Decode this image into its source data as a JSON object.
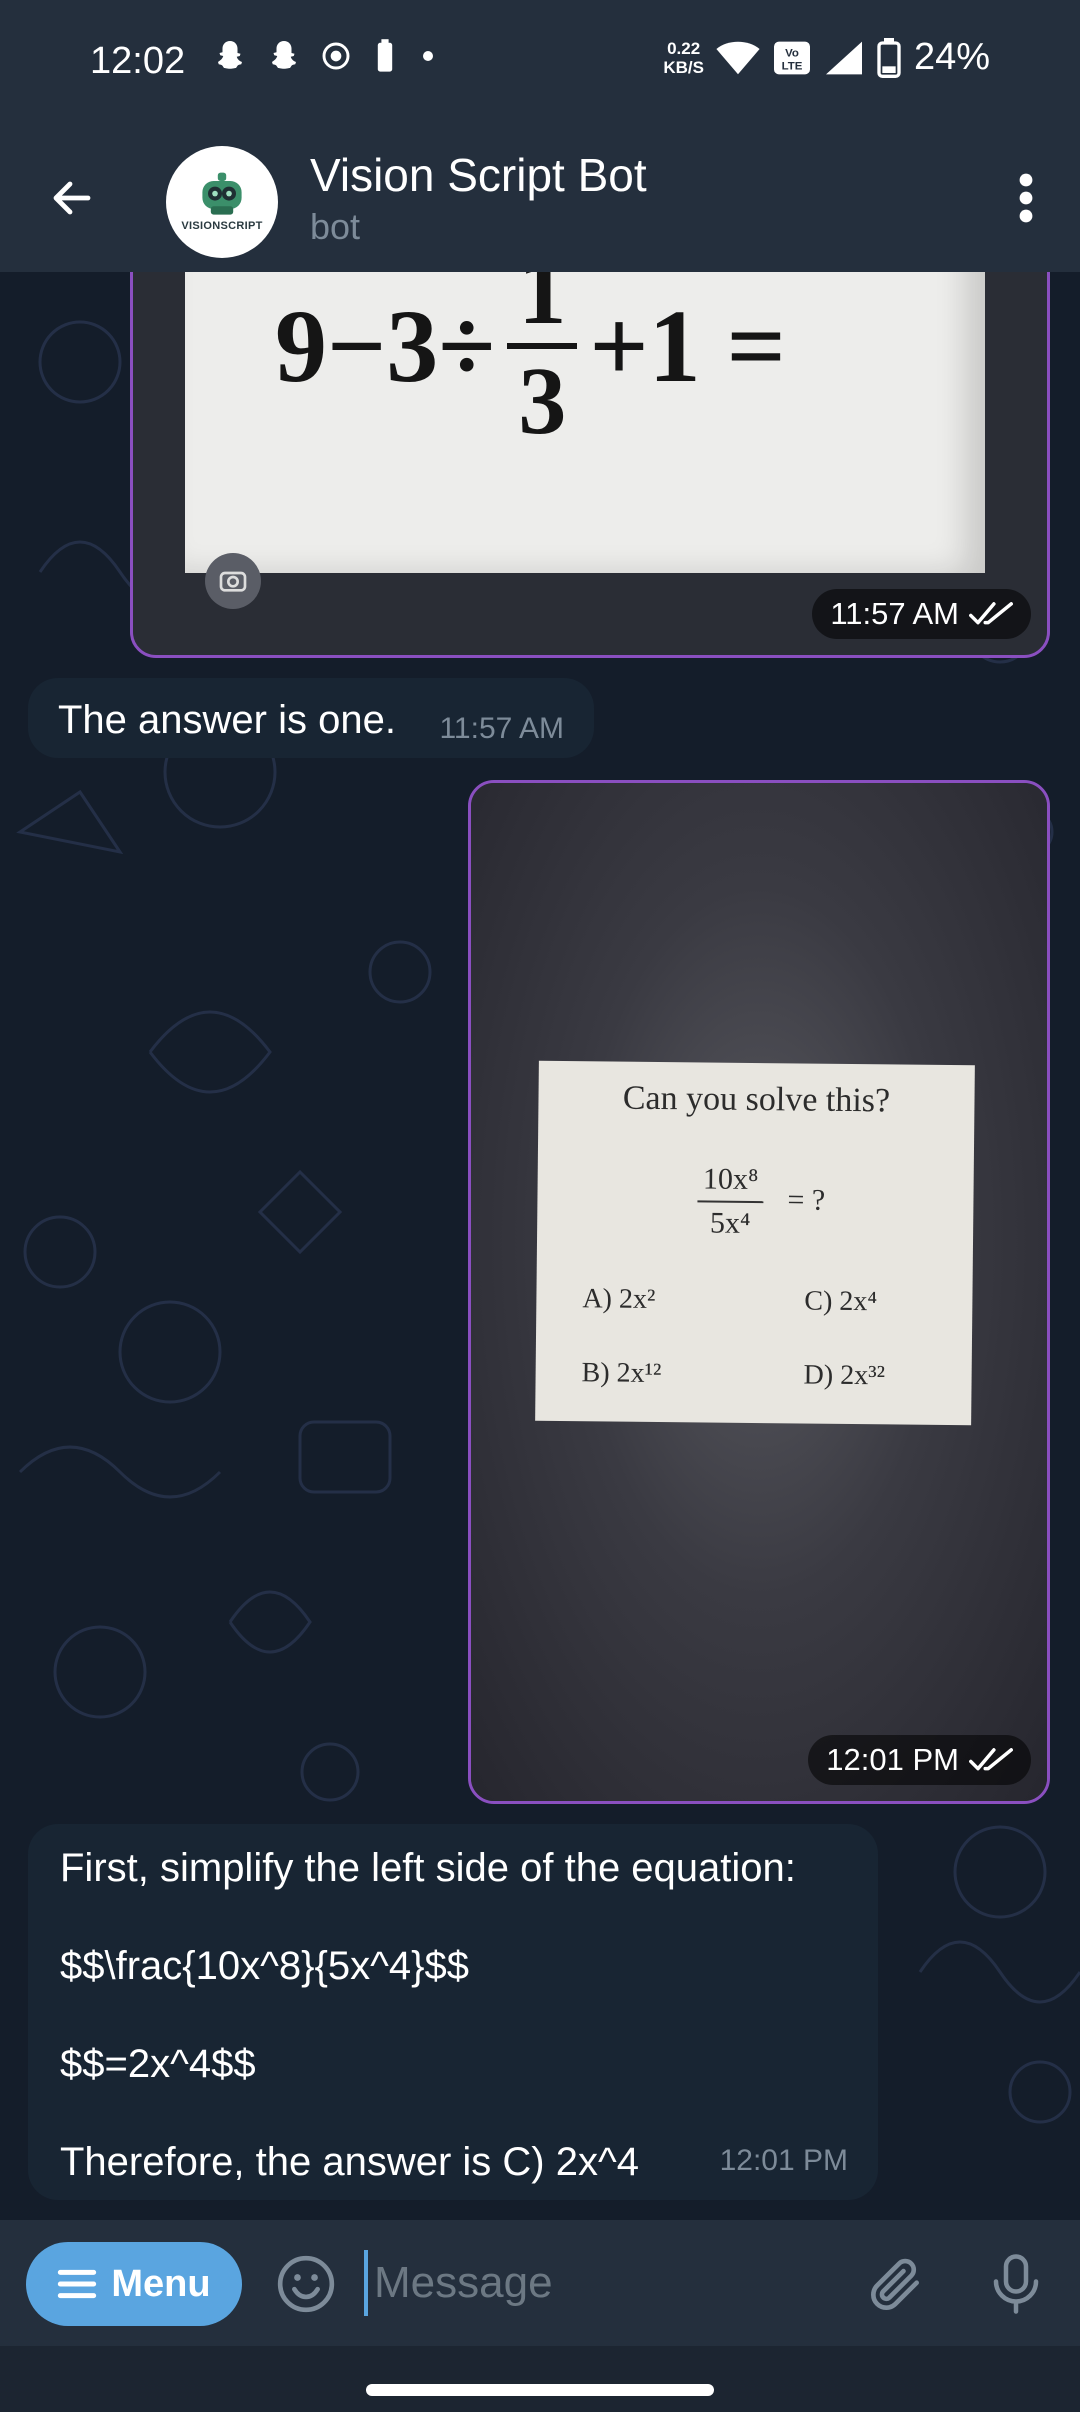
{
  "status_bar": {
    "time": "12:02",
    "speed_value": "0.22",
    "speed_unit": "KB/S",
    "volte": "Vo LTE",
    "battery_pct": "24%"
  },
  "header": {
    "title": "Vision Script Bot",
    "subtitle": "bot",
    "avatar_logo_text": "VISIONSCRIPT"
  },
  "messages": {
    "photo1": {
      "eq_left": "9−3÷",
      "frac_num": "1",
      "frac_den": "3",
      "eq_right": "+1 =",
      "time": "11:57 AM"
    },
    "reply1": {
      "text": "The answer is one.",
      "time": "11:57 AM"
    },
    "photo2": {
      "question": "Can you solve this?",
      "frac_num": "10x⁸",
      "frac_den": "5x⁴",
      "equals": "= ?",
      "opt_a": "A) 2x²",
      "opt_b": "B) 2x¹²",
      "opt_c": "C) 2x⁴",
      "opt_d": "D) 2x³²",
      "time": "12:01 PM"
    },
    "reply2": {
      "line1": "First, simplify the left side of the equation:",
      "line2": "$$\\frac{10x^8}{5x^4}$$",
      "line3": "$$=2x^4$$",
      "line4": "Therefore, the answer is C) 2x^4",
      "time": "12:01 PM"
    }
  },
  "input_bar": {
    "menu_label": "Menu",
    "placeholder": "Message"
  },
  "colors": {
    "header_bg": "#242f3d",
    "chat_bg": "#141d2a",
    "incoming_bubble": "#182533",
    "accent": "#5aa5e0",
    "photo_border": "#8a4fc0"
  }
}
